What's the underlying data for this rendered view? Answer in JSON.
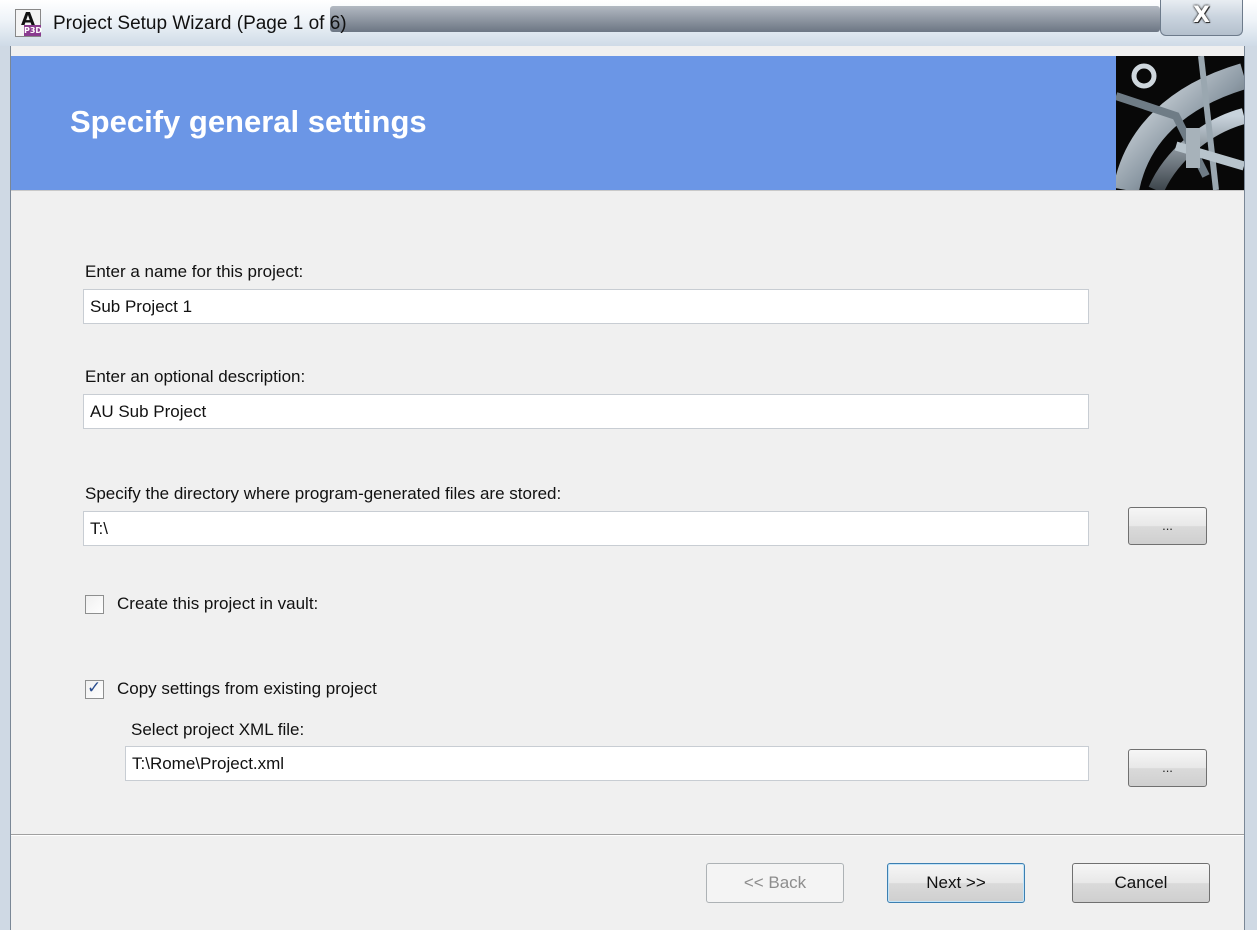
{
  "window": {
    "title": "Project Setup Wizard (Page 1 of 6)",
    "app_icon_letter": "A",
    "app_icon_badge": "P3D",
    "close_glyph": "X"
  },
  "header": {
    "title": "Specify general settings",
    "background_color": "#6b96e6"
  },
  "form": {
    "name_label": "Enter a name for this project:",
    "name_value": "Sub Project 1",
    "description_label": "Enter an optional description:",
    "description_value": "AU Sub Project",
    "directory_label": "Specify the directory where program-generated files are stored:",
    "directory_value": "T:\\",
    "directory_browse_label": "...",
    "vault_checkbox_label": "Create this project in vault:",
    "vault_checked": false,
    "copy_checkbox_label": "Copy settings from existing project",
    "copy_checked": true,
    "xml_label": "Select project XML file:",
    "xml_value": "T:\\Rome\\Project.xml",
    "xml_browse_label": "..."
  },
  "footer": {
    "back_label": "<< Back",
    "next_label": "Next >>",
    "cancel_label": "Cancel"
  }
}
